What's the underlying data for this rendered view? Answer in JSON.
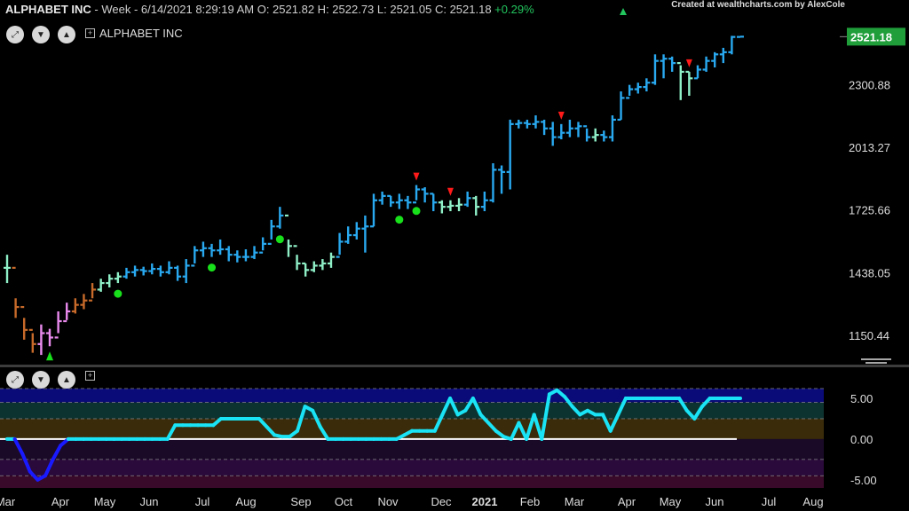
{
  "header": {
    "symbol": "ALPHABET INC",
    "period": " - Week - 6/14/2021 8:29:19 AM",
    "open": " O: 2521.82",
    "high": " H: 2522.73",
    "low": " L: 2521.05",
    "close": " C: 2521.18",
    "change": " +0.29%",
    "credit": "Created at wealthcharts.com by AlexCole"
  },
  "legend": {
    "title": "ALPHABET INC"
  },
  "controls": {
    "expand_icon": "expand-icon",
    "down_icon": "chevron-down-icon",
    "up_icon": "chevron-up-icon",
    "add_icon": "plus-box-icon"
  },
  "colors": {
    "strong_up": "#29a9f0",
    "weak_up": "#8ff0c8",
    "weak_down": "#e98aed",
    "strong_down": "#c76a2a",
    "osc_line": "#19e3f5",
    "osc_neg": "#1a1aff",
    "last_badge": "#1f9e3a"
  },
  "chart_data": [
    {
      "type": "bar",
      "title": "ALPHABET INC",
      "timeframe": "Week",
      "x_labels": [
        "Mar",
        "Apr",
        "May",
        "Jun",
        "Jul",
        "Aug",
        "Sep",
        "Oct",
        "Nov",
        "Dec",
        "2021",
        "Feb",
        "Mar",
        "Apr",
        "May",
        "Jun",
        "Jul",
        "Aug"
      ],
      "y_ticks": [
        "2521.18",
        "2300.88",
        "2013.27",
        "1725.66",
        "1438.05",
        "1150.44"
      ],
      "ylim": [
        1040,
        2600
      ],
      "last_price": "2521.18",
      "bars": [
        {
          "c": 1460,
          "h": 1520,
          "l": 1390,
          "s": "weak_up"
        },
        {
          "c": 1280,
          "h": 1320,
          "l": 1230,
          "s": "strong_down"
        },
        {
          "c": 1175,
          "h": 1230,
          "l": 1130,
          "s": "strong_down"
        },
        {
          "c": 1110,
          "h": 1160,
          "l": 1070,
          "s": "strong_down"
        },
        {
          "c": 1160,
          "h": 1200,
          "l": 1060,
          "s": "weak_down"
        },
        {
          "c": 1140,
          "h": 1180,
          "l": 1100,
          "s": "weak_down"
        },
        {
          "c": 1215,
          "h": 1260,
          "l": 1160,
          "s": "weak_down"
        },
        {
          "c": 1260,
          "h": 1300,
          "l": 1220,
          "s": "weak_down"
        },
        {
          "c": 1290,
          "h": 1320,
          "l": 1250,
          "s": "strong_down"
        },
        {
          "c": 1310,
          "h": 1340,
          "l": 1270,
          "s": "strong_down"
        },
        {
          "c": 1360,
          "h": 1390,
          "l": 1320,
          "s": "strong_down"
        },
        {
          "c": 1390,
          "h": 1410,
          "l": 1350,
          "s": "weak_up"
        },
        {
          "c": 1410,
          "h": 1430,
          "l": 1370,
          "s": "weak_up"
        },
        {
          "c": 1420,
          "h": 1440,
          "l": 1390,
          "s": "weak_up"
        },
        {
          "c": 1440,
          "h": 1460,
          "l": 1410,
          "s": "strong_up"
        },
        {
          "c": 1450,
          "h": 1470,
          "l": 1420,
          "s": "strong_up"
        },
        {
          "c": 1445,
          "h": 1465,
          "l": 1425,
          "s": "strong_up"
        },
        {
          "c": 1455,
          "h": 1480,
          "l": 1430,
          "s": "strong_up"
        },
        {
          "c": 1440,
          "h": 1470,
          "l": 1420,
          "s": "strong_up"
        },
        {
          "c": 1460,
          "h": 1490,
          "l": 1430,
          "s": "strong_up"
        },
        {
          "c": 1420,
          "h": 1470,
          "l": 1400,
          "s": "strong_up"
        },
        {
          "c": 1470,
          "h": 1500,
          "l": 1390,
          "s": "strong_up"
        },
        {
          "c": 1540,
          "h": 1560,
          "l": 1480,
          "s": "strong_up"
        },
        {
          "c": 1550,
          "h": 1580,
          "l": 1510,
          "s": "strong_up"
        },
        {
          "c": 1540,
          "h": 1570,
          "l": 1510,
          "s": "strong_up"
        },
        {
          "c": 1545,
          "h": 1590,
          "l": 1520,
          "s": "strong_up"
        },
        {
          "c": 1520,
          "h": 1560,
          "l": 1490,
          "s": "strong_up"
        },
        {
          "c": 1510,
          "h": 1540,
          "l": 1485,
          "s": "strong_up"
        },
        {
          "c": 1510,
          "h": 1545,
          "l": 1490,
          "s": "strong_up"
        },
        {
          "c": 1530,
          "h": 1560,
          "l": 1500,
          "s": "strong_up"
        },
        {
          "c": 1570,
          "h": 1600,
          "l": 1540,
          "s": "strong_up"
        },
        {
          "c": 1650,
          "h": 1680,
          "l": 1590,
          "s": "strong_up"
        },
        {
          "c": 1700,
          "h": 1740,
          "l": 1640,
          "s": "strong_up"
        },
        {
          "c": 1560,
          "h": 1590,
          "l": 1510,
          "s": "weak_up"
        },
        {
          "c": 1480,
          "h": 1520,
          "l": 1450,
          "s": "weak_up"
        },
        {
          "c": 1450,
          "h": 1480,
          "l": 1420,
          "s": "weak_up"
        },
        {
          "c": 1470,
          "h": 1490,
          "l": 1440,
          "s": "weak_up"
        },
        {
          "c": 1480,
          "h": 1500,
          "l": 1450,
          "s": "weak_up"
        },
        {
          "c": 1510,
          "h": 1530,
          "l": 1460,
          "s": "weak_up"
        },
        {
          "c": 1580,
          "h": 1620,
          "l": 1520,
          "s": "strong_up"
        },
        {
          "c": 1610,
          "h": 1650,
          "l": 1570,
          "s": "strong_up"
        },
        {
          "c": 1640,
          "h": 1670,
          "l": 1590,
          "s": "strong_up"
        },
        {
          "c": 1650,
          "h": 1700,
          "l": 1530,
          "s": "strong_up"
        },
        {
          "c": 1770,
          "h": 1800,
          "l": 1650,
          "s": "strong_up"
        },
        {
          "c": 1790,
          "h": 1810,
          "l": 1750,
          "s": "strong_up"
        },
        {
          "c": 1760,
          "h": 1790,
          "l": 1740,
          "s": "strong_up"
        },
        {
          "c": 1770,
          "h": 1800,
          "l": 1730,
          "s": "strong_up"
        },
        {
          "c": 1760,
          "h": 1790,
          "l": 1730,
          "s": "strong_up"
        },
        {
          "c": 1820,
          "h": 1840,
          "l": 1770,
          "s": "strong_up"
        },
        {
          "c": 1800,
          "h": 1830,
          "l": 1760,
          "s": "strong_up"
        },
        {
          "c": 1760,
          "h": 1800,
          "l": 1720,
          "s": "strong_up"
        },
        {
          "c": 1740,
          "h": 1770,
          "l": 1710,
          "s": "weak_up"
        },
        {
          "c": 1745,
          "h": 1770,
          "l": 1720,
          "s": "weak_up"
        },
        {
          "c": 1750,
          "h": 1780,
          "l": 1720,
          "s": "weak_up"
        },
        {
          "c": 1780,
          "h": 1810,
          "l": 1740,
          "s": "strong_up"
        },
        {
          "c": 1740,
          "h": 1790,
          "l": 1700,
          "s": "weak_up"
        },
        {
          "c": 1770,
          "h": 1810,
          "l": 1720,
          "s": "strong_up"
        },
        {
          "c": 1910,
          "h": 1940,
          "l": 1760,
          "s": "strong_up"
        },
        {
          "c": 1900,
          "h": 1930,
          "l": 1800,
          "s": "strong_up"
        },
        {
          "c": 2120,
          "h": 2140,
          "l": 1820,
          "s": "strong_up"
        },
        {
          "c": 2125,
          "h": 2140,
          "l": 2100,
          "s": "strong_up"
        },
        {
          "c": 2120,
          "h": 2140,
          "l": 2100,
          "s": "strong_up"
        },
        {
          "c": 2130,
          "h": 2160,
          "l": 2100,
          "s": "strong_up"
        },
        {
          "c": 2100,
          "h": 2140,
          "l": 2070,
          "s": "strong_up"
        },
        {
          "c": 2060,
          "h": 2130,
          "l": 2020,
          "s": "strong_up"
        },
        {
          "c": 2080,
          "h": 2120,
          "l": 2050,
          "s": "strong_up"
        },
        {
          "c": 2100,
          "h": 2140,
          "l": 2060,
          "s": "strong_up"
        },
        {
          "c": 2110,
          "h": 2130,
          "l": 2060,
          "s": "strong_up"
        },
        {
          "c": 2060,
          "h": 2100,
          "l": 2040,
          "s": "strong_up"
        },
        {
          "c": 2070,
          "h": 2100,
          "l": 2040,
          "s": "weak_up"
        },
        {
          "c": 2060,
          "h": 2090,
          "l": 2040,
          "s": "strong_up"
        },
        {
          "c": 2140,
          "h": 2160,
          "l": 2040,
          "s": "strong_up"
        },
        {
          "c": 2240,
          "h": 2270,
          "l": 2140,
          "s": "strong_up"
        },
        {
          "c": 2280,
          "h": 2300,
          "l": 2250,
          "s": "strong_up"
        },
        {
          "c": 2290,
          "h": 2310,
          "l": 2260,
          "s": "strong_up"
        },
        {
          "c": 2310,
          "h": 2330,
          "l": 2270,
          "s": "strong_up"
        },
        {
          "c": 2410,
          "h": 2440,
          "l": 2300,
          "s": "strong_up"
        },
        {
          "c": 2420,
          "h": 2440,
          "l": 2330,
          "s": "strong_up"
        },
        {
          "c": 2400,
          "h": 2430,
          "l": 2360,
          "s": "strong_up"
        },
        {
          "c": 2360,
          "h": 2390,
          "l": 2230,
          "s": "weak_up"
        },
        {
          "c": 2330,
          "h": 2360,
          "l": 2250,
          "s": "weak_up"
        },
        {
          "c": 2370,
          "h": 2390,
          "l": 2330,
          "s": "strong_up"
        },
        {
          "c": 2410,
          "h": 2430,
          "l": 2360,
          "s": "strong_up"
        },
        {
          "c": 2440,
          "h": 2450,
          "l": 2380,
          "s": "strong_up"
        },
        {
          "c": 2450,
          "h": 2470,
          "l": 2400,
          "s": "strong_up"
        },
        {
          "c": 2520,
          "h": 2525,
          "l": 2440,
          "s": "strong_up"
        },
        {
          "c": 2521.18,
          "h": 2522.73,
          "l": 2521.05,
          "s": "strong_up"
        }
      ],
      "buy_signals": [
        {
          "bar": 6,
          "type": "triangle-up"
        }
      ],
      "sell_signals": [
        {
          "bar": 57,
          "type": "triangle-down"
        },
        {
          "bar": 61,
          "type": "triangle-down"
        },
        {
          "bar": 78,
          "type": "triangle-down"
        },
        {
          "bar": 95,
          "type": "triangle-down"
        }
      ],
      "dots": [
        13,
        24,
        32,
        46,
        48
      ],
      "triangle_down_bars": [
        48,
        52,
        65,
        80
      ],
      "triangle_up_bars": [
        5
      ]
    },
    {
      "type": "line",
      "title": "",
      "y_ticks": [
        "5.00",
        "0.00",
        "-5.00"
      ],
      "ylim": [
        -6,
        6.2
      ],
      "zero_line": true,
      "values": [
        0,
        0,
        -1.8,
        -4,
        -5,
        -4.5,
        -2.5,
        -0.8,
        0,
        0,
        0,
        0,
        0,
        0,
        0,
        0,
        0,
        0,
        0,
        0,
        0,
        0,
        1.7,
        1.7,
        1.7,
        1.7,
        1.7,
        1.7,
        2.5,
        2.5,
        2.5,
        2.5,
        2.5,
        2.5,
        1.5,
        0.5,
        0.3,
        0.3,
        1,
        4,
        3.5,
        1.5,
        0,
        0,
        0,
        0,
        0,
        0,
        0,
        0,
        0,
        0,
        0.5,
        1,
        1,
        1,
        1,
        3,
        5,
        3,
        3.5,
        5,
        3,
        2,
        1,
        0.3,
        0,
        2,
        0,
        3,
        0,
        5.5,
        6,
        5.2,
        4,
        3,
        3.5,
        3,
        3,
        1,
        3,
        5,
        5,
        5,
        5,
        5,
        5,
        5,
        5,
        3.5,
        2.5,
        4,
        5,
        5,
        5,
        5,
        5
      ]
    }
  ]
}
